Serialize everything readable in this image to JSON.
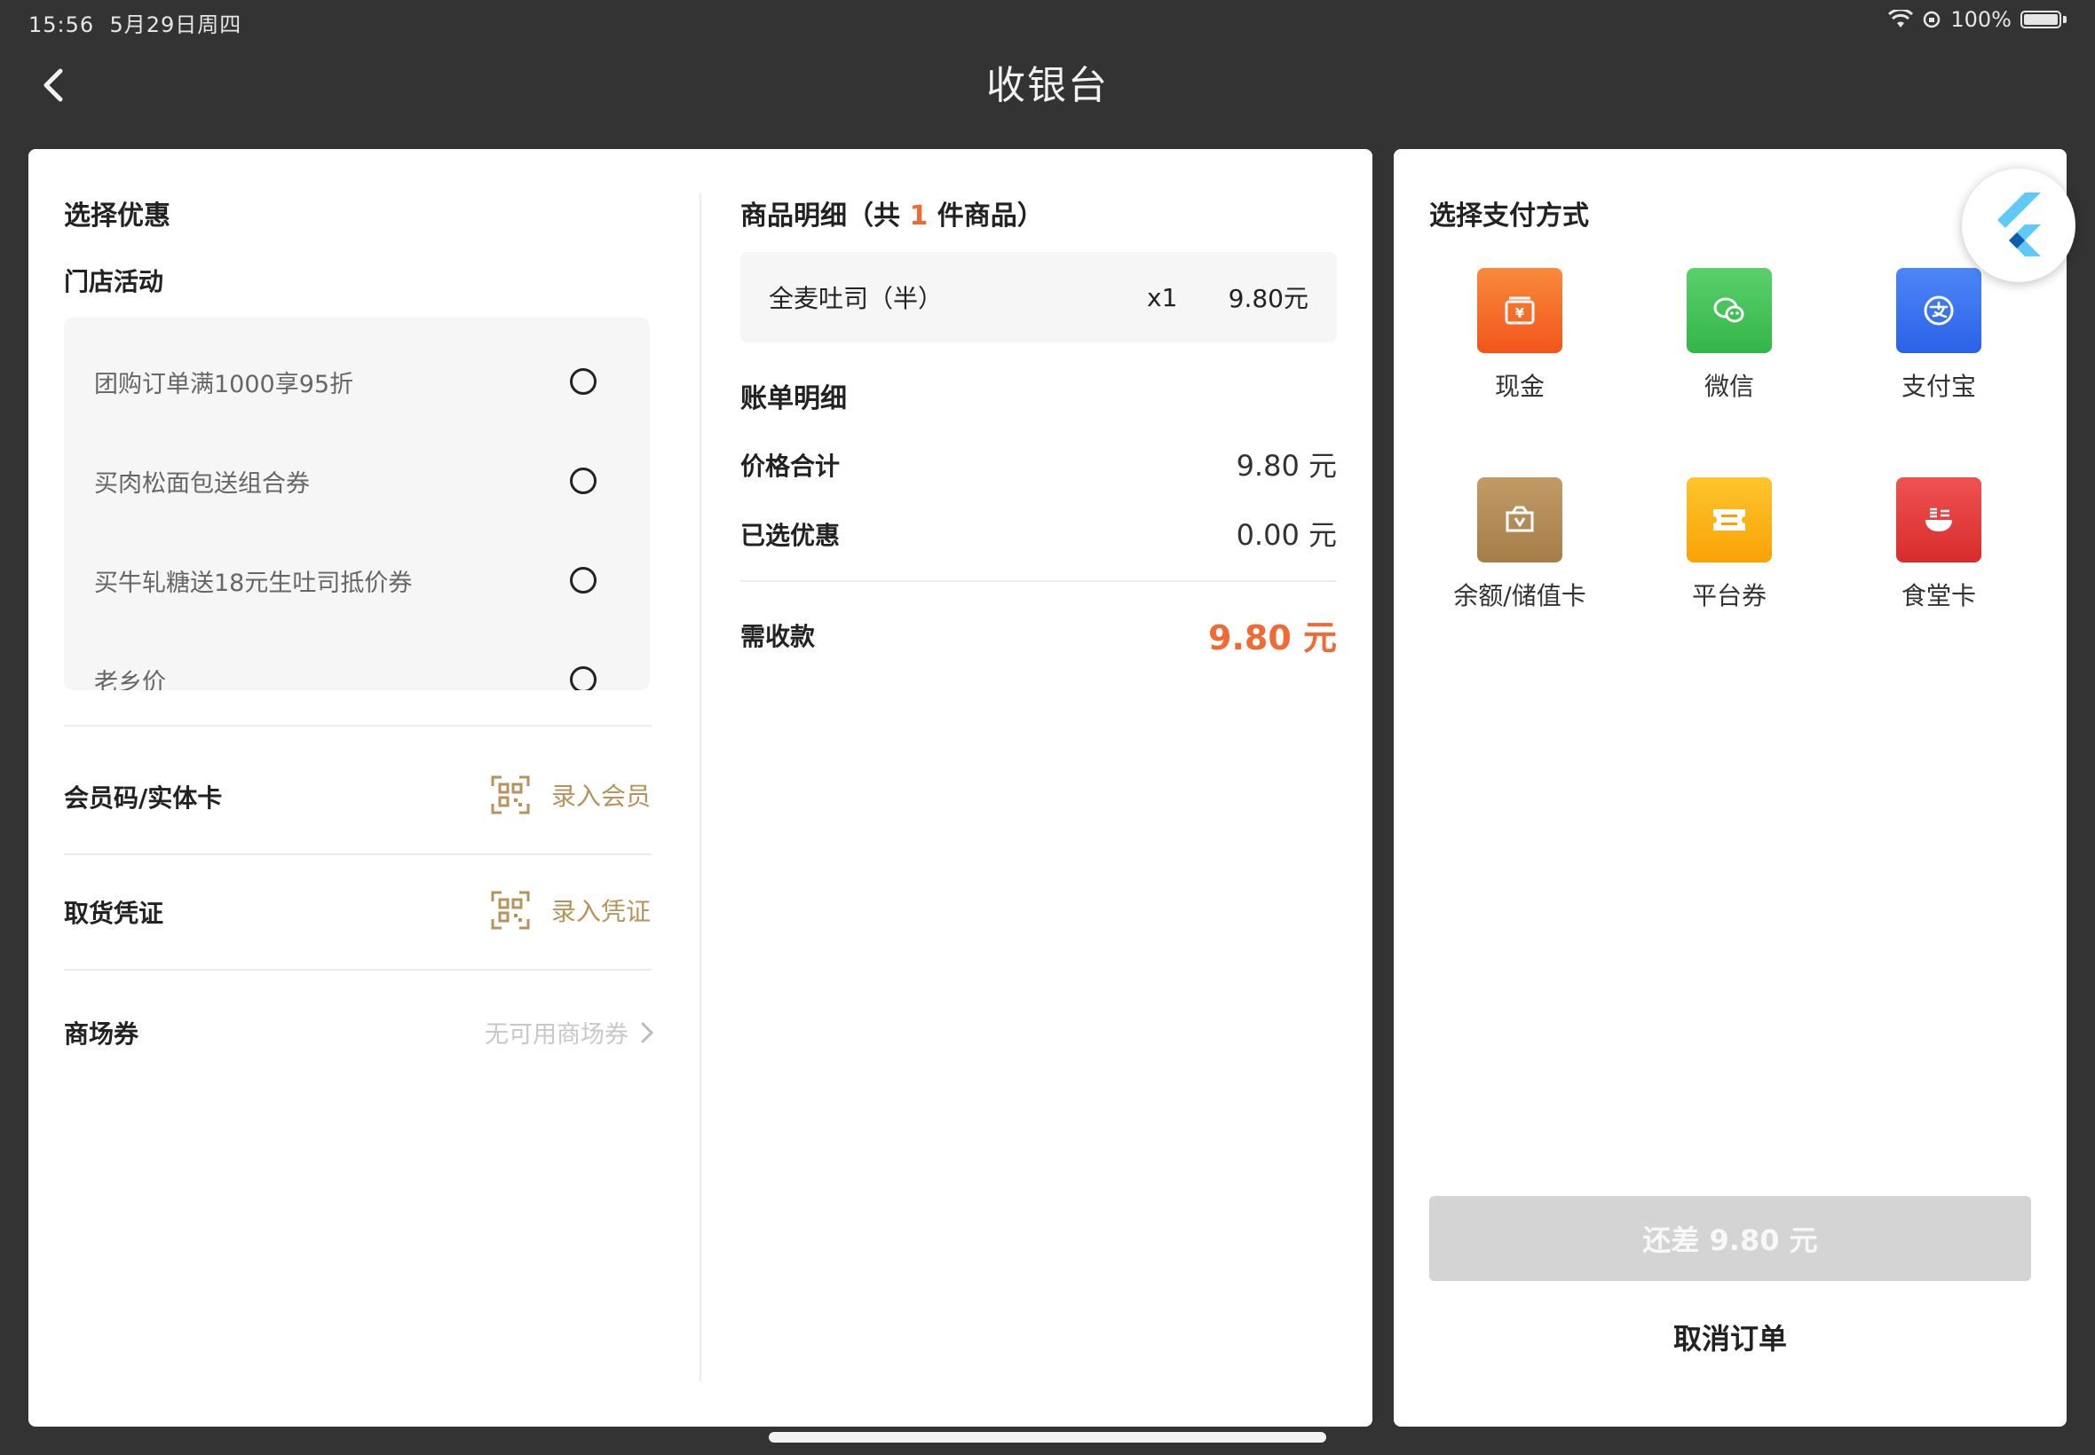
{
  "status_bar": {
    "time": "15:56",
    "date": "5月29日周四",
    "battery": "100%"
  },
  "header": {
    "title": "收银台"
  },
  "discount": {
    "title": "选择优惠",
    "store_activity_title": "门店活动",
    "activities": [
      {
        "label": "团购订单满1000享95折"
      },
      {
        "label": "买肉松面包送组合券"
      },
      {
        "label": "买牛轧糖送18元生吐司抵价券"
      },
      {
        "label": "老乡价"
      }
    ],
    "member": {
      "label": "会员码/实体卡",
      "action": "录入会员"
    },
    "voucher": {
      "label": "取货凭证",
      "action": "录入凭证"
    },
    "mall_coupon": {
      "label": "商场券",
      "value": "无可用商场券"
    }
  },
  "goods": {
    "title_prefix": "商品明细（共 ",
    "count": "1",
    "title_suffix": " 件商品）",
    "items": [
      {
        "name": "全麦吐司（半）",
        "qty": "x1",
        "price": "9.80元"
      }
    ]
  },
  "bill": {
    "title": "账单明细",
    "total_label": "价格合计",
    "total_value": "9.80 元",
    "discount_label": "已选优惠",
    "discount_value": "0.00 元",
    "due_label": "需收款",
    "due_value": "9.80 元"
  },
  "payment": {
    "title": "选择支付方式",
    "methods": [
      {
        "label": "现金",
        "icon": "cash-icon",
        "color": "#f4611d"
      },
      {
        "label": "微信",
        "icon": "wechat-icon",
        "color": "#3cc051"
      },
      {
        "label": "支付宝",
        "icon": "alipay-icon",
        "color": "#2f6ff0"
      },
      {
        "label": "余额/储值卡",
        "icon": "stored-value-card-icon",
        "color": "#b08a55"
      },
      {
        "label": "平台券",
        "icon": "platform-coupon-icon",
        "color": "#fbb40e"
      },
      {
        "label": "食堂卡",
        "icon": "canteen-card-icon",
        "color": "#e23c3c"
      }
    ],
    "remaining_button": "还差 9.80 元",
    "cancel_button": "取消订单"
  }
}
